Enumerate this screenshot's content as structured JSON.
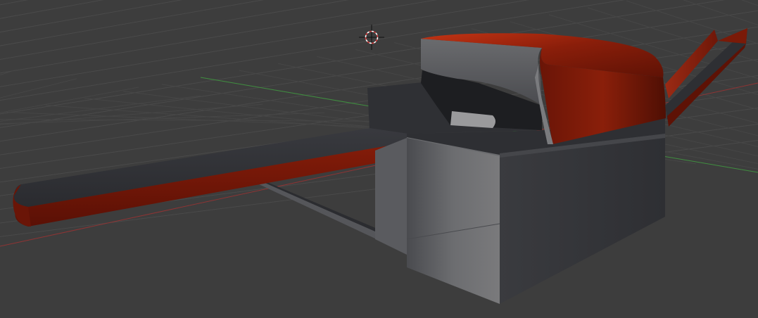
{
  "viewport": {
    "background": "#3d3d3d",
    "grid_color": "#4a4a4a",
    "x_axis_color": "#a33a3a",
    "y_axis_color": "#3fa33f"
  },
  "model": {
    "accent_color": "#b52a12",
    "dark_color": "#2f3034",
    "mid_color": "#5a5b5f",
    "light_color": "#8a8a8a"
  },
  "cursor": {
    "icon": "3d-cursor-icon",
    "ring_red": "#d43c3c",
    "ring_white": "#ffffff"
  }
}
